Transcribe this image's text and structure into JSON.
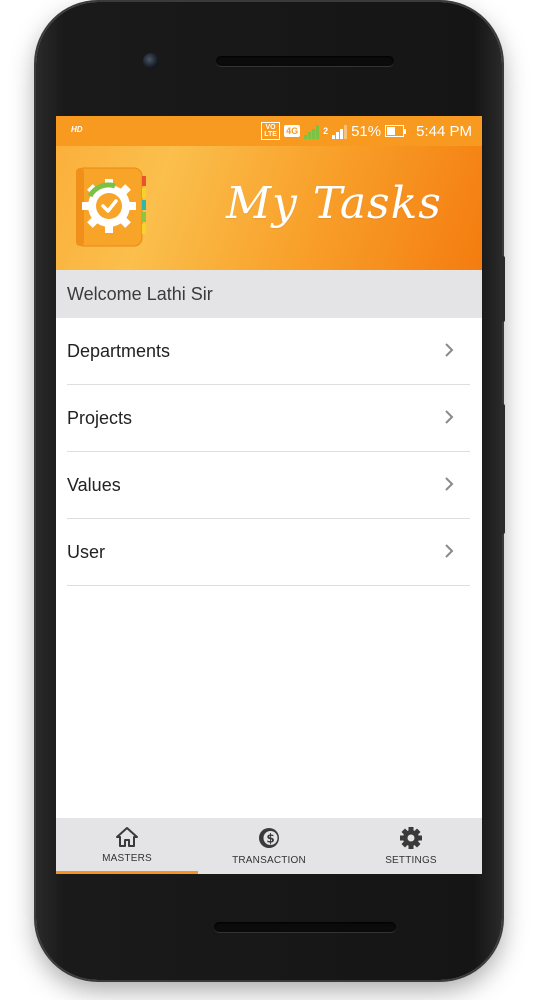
{
  "status_bar": {
    "hd": "HD",
    "volte": "VO LTE",
    "network": "4G",
    "sim2": "2",
    "battery": "51%",
    "time": "5:44 PM"
  },
  "header": {
    "title": "My Tasks",
    "logo_icon": "gear-check-notebook-icon"
  },
  "welcome": "Welcome Lathi Sir",
  "menu": [
    {
      "label": "Departments",
      "icon": "chevron-right-icon"
    },
    {
      "label": "Projects",
      "icon": "chevron-right-icon"
    },
    {
      "label": "Values",
      "icon": "chevron-right-icon"
    },
    {
      "label": "User",
      "icon": "chevron-right-icon"
    }
  ],
  "bottom_nav": [
    {
      "label": "MASTERS",
      "icon": "home-icon",
      "active": true
    },
    {
      "label": "TRANSACTION",
      "icon": "dollar-coin-icon",
      "active": false
    },
    {
      "label": "SETTINGS",
      "icon": "gear-icon",
      "active": false
    }
  ],
  "colors": {
    "accent": "#f7941d",
    "status_bar": "#f79a1f",
    "nav_bg": "#e4e4e6"
  }
}
